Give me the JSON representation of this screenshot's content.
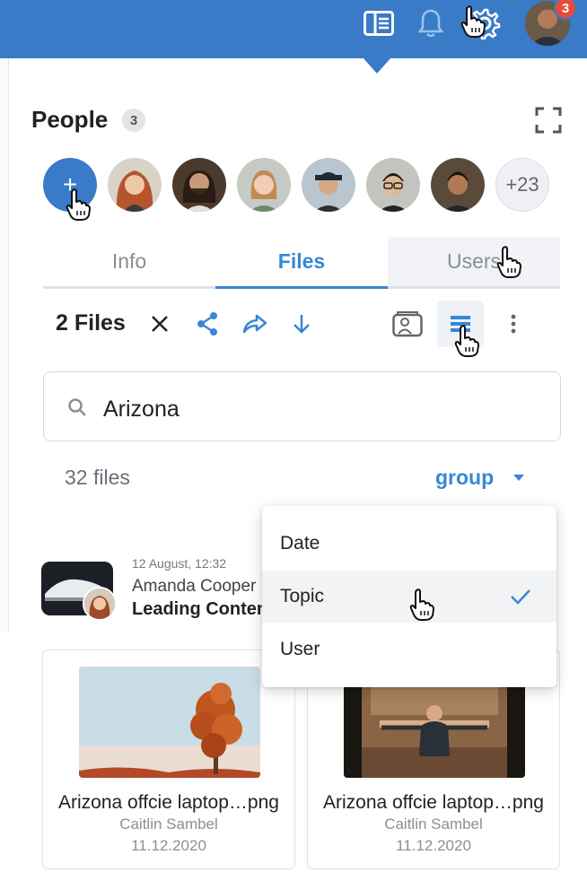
{
  "topbar": {
    "notification_badge": "3",
    "icons": [
      "sidebar-layout-icon",
      "bell-icon",
      "gear-icon"
    ]
  },
  "people": {
    "title": "People",
    "count": "3",
    "add_label": "+",
    "more_count": "+23"
  },
  "tabs": [
    {
      "label": "Info"
    },
    {
      "label": "Files"
    },
    {
      "label": "Users"
    }
  ],
  "toolbar": {
    "selected_count": "2 Files"
  },
  "search": {
    "value": "Arizona"
  },
  "files": {
    "total": "32 files",
    "group_label": "group"
  },
  "feed_item": {
    "date": "12 August, 12:32",
    "author": "Amanda Cooper",
    "title": "Leading Content"
  },
  "cards": [
    {
      "name": "Arizona offcie laptop…png",
      "author": "Caitlin Sambel",
      "date": "11.12.2020"
    },
    {
      "name": "Arizona offcie laptop…png",
      "author": "Caitlin Sambel",
      "date": "11.12.2020"
    }
  ],
  "group_menu": {
    "options": [
      {
        "label": "Date"
      },
      {
        "label": "Topic"
      },
      {
        "label": "User"
      }
    ],
    "selected": "Topic"
  },
  "colors": {
    "accent": "#3a7bc8",
    "link": "#3a86d6",
    "badge": "#e74a3b"
  }
}
